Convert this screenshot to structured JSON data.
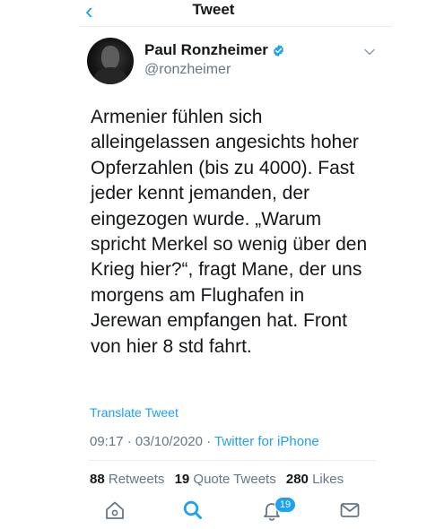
{
  "header": {
    "title": "Tweet",
    "back_icon": "chevron-left-icon",
    "accent_color": "#1da1f2"
  },
  "author": {
    "display_name": "Paul Ronzheimer",
    "handle": "@ronzheimer",
    "verified": true
  },
  "tweet": {
    "lines": [
      "Armenier fühlen sich",
      "alleingelassen angesichts hoher",
      "Opferzahlen (bis zu 4000). Fast",
      "jeder kennt jemanden, der",
      "eingezogen wurde. „Warum",
      "spricht Merkel so wenig über den",
      "Krieg hier?“,  fragt Mane, der uns",
      "morgens am Flughafen in",
      "Jerewan empfangen hat. Front",
      "von hier 8 std fahrt."
    ],
    "translate_label": "Translate Tweet",
    "time": "09:17",
    "date": "03/10/2020",
    "separator": "·",
    "source": "Twitter for iPhone"
  },
  "stats": {
    "retweets_count": "88",
    "retweets_label": "Retweets",
    "quote_count": "19",
    "quote_label": "Quote Tweets",
    "likes_count": "280",
    "likes_label": "Likes"
  },
  "tabbar": {
    "items": [
      {
        "name": "home",
        "icon": "home-icon"
      },
      {
        "name": "search",
        "icon": "search-icon",
        "active": true
      },
      {
        "name": "notifications",
        "icon": "bell-icon",
        "badge": "19"
      },
      {
        "name": "messages",
        "icon": "mail-icon"
      }
    ]
  }
}
